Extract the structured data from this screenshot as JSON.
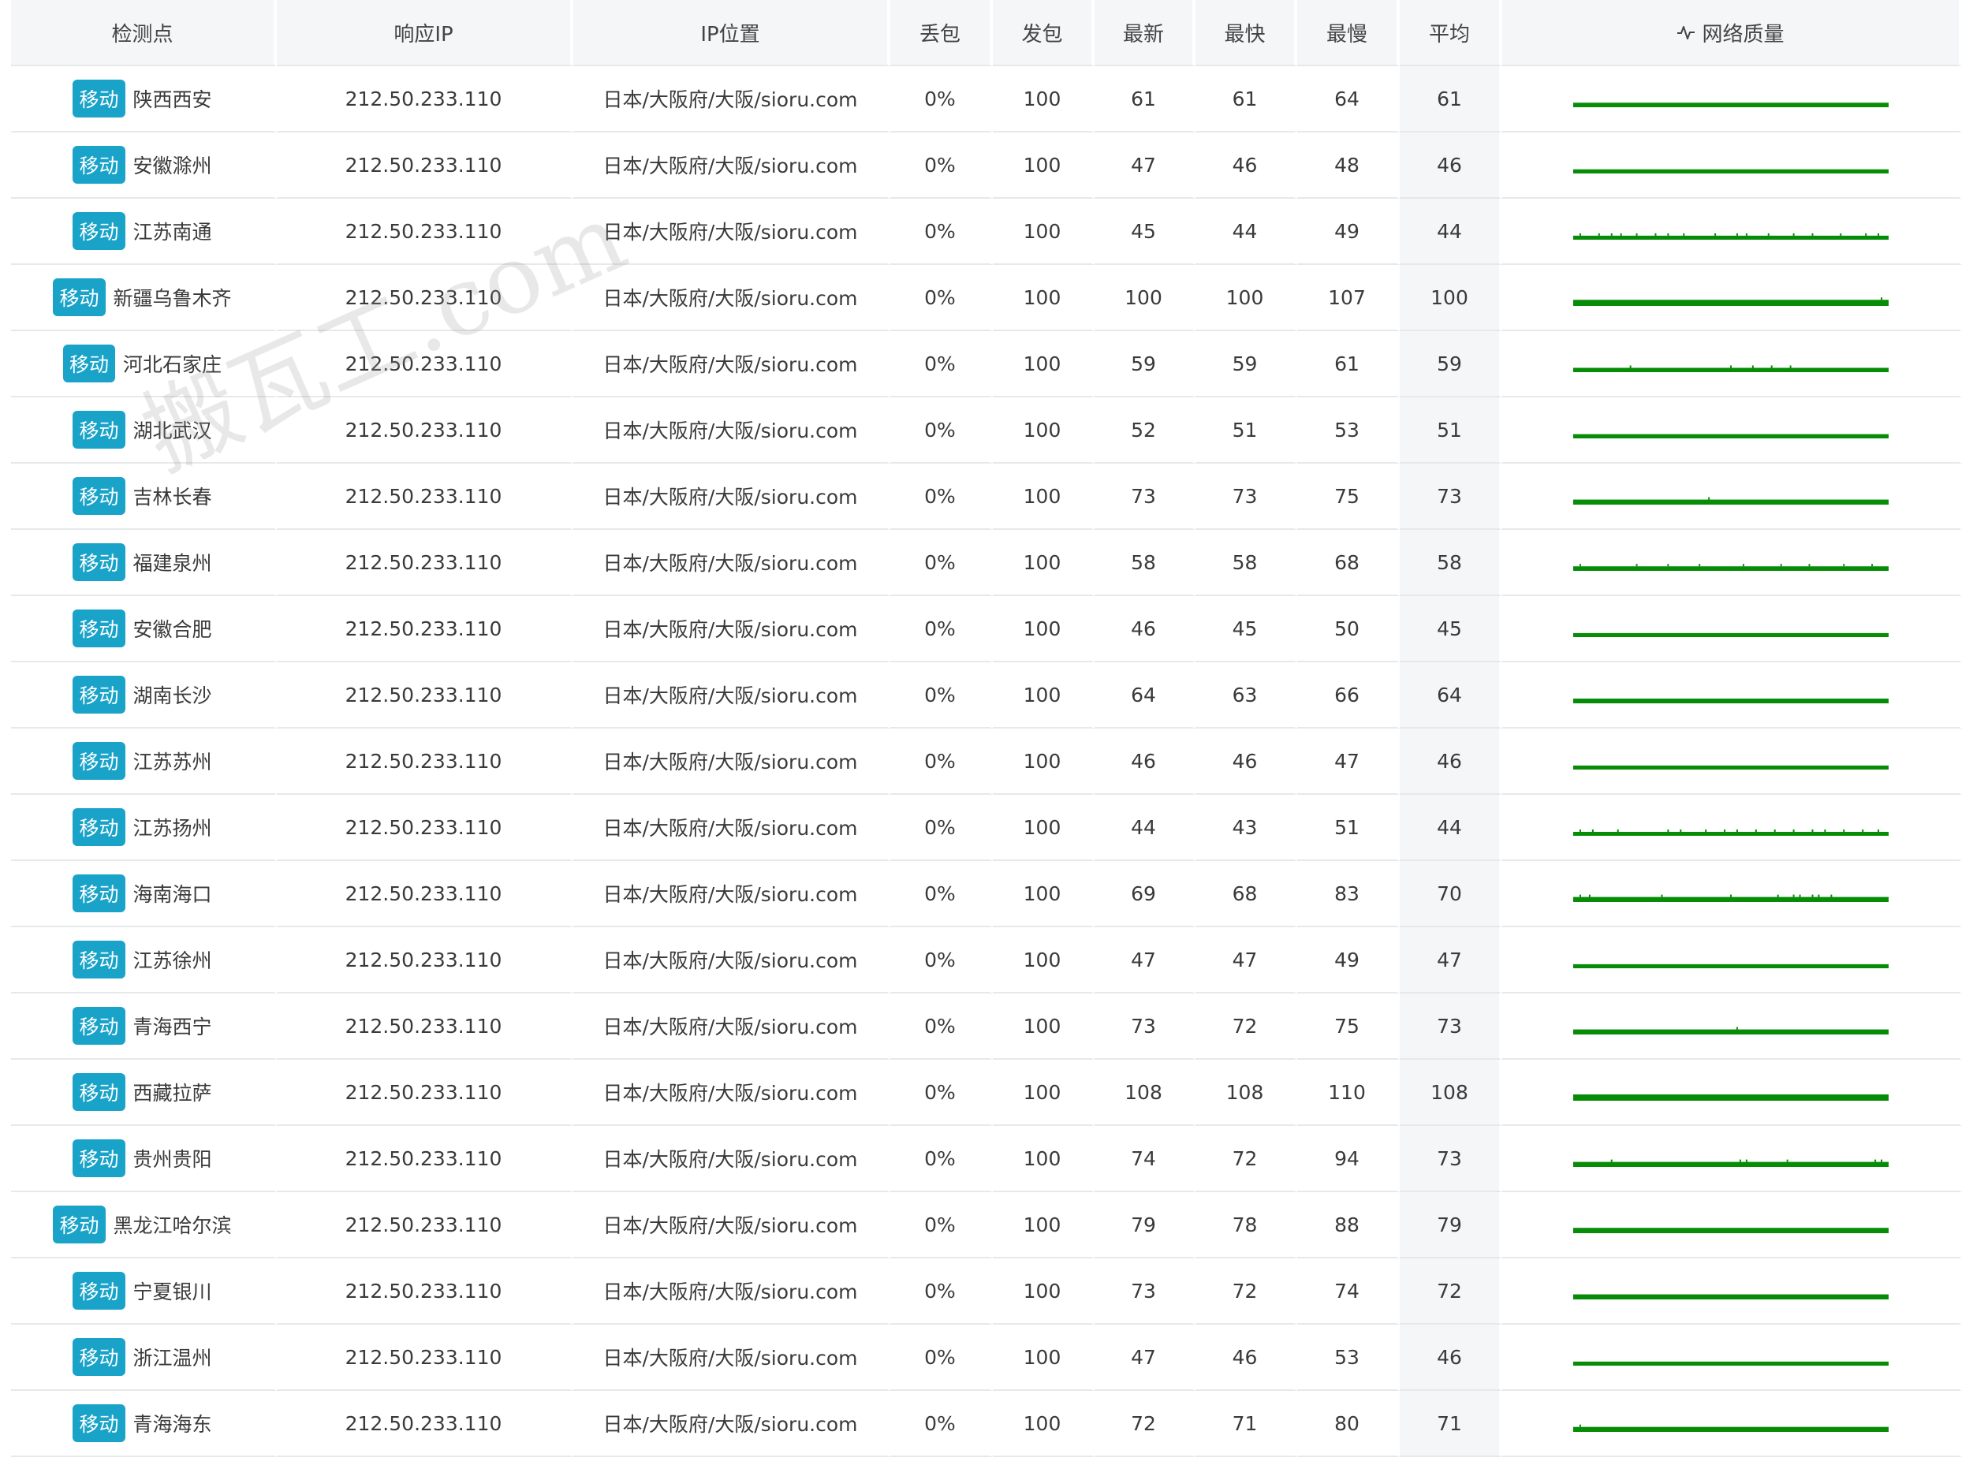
{
  "columns": [
    "检测点",
    "响应IP",
    "IP位置",
    "丢包",
    "发包",
    "最新",
    "最快",
    "最慢",
    "平均",
    "网络质量"
  ],
  "quality_color": "#078c07",
  "badge_color": "#1aa3c9",
  "watermark": "搬瓦工.com",
  "rows": [
    {
      "isp": "移动",
      "node": "陕西西安",
      "ip": "212.50.233.110",
      "location": "日本/大阪府/大阪/sioru.com",
      "loss": "0%",
      "sent": "100",
      "latest": "61",
      "fastest": "61",
      "slowest": "64",
      "avg": "61",
      "quality_level": 0.55,
      "spikes": []
    },
    {
      "isp": "移动",
      "node": "安徽滁州",
      "ip": "212.50.233.110",
      "location": "日本/大阪府/大阪/sioru.com",
      "loss": "0%",
      "sent": "100",
      "latest": "47",
      "fastest": "46",
      "slowest": "48",
      "avg": "46",
      "quality_level": 0.45,
      "spikes": []
    },
    {
      "isp": "移动",
      "node": "江苏南通",
      "ip": "212.50.233.110",
      "location": "日本/大阪府/大阪/sioru.com",
      "loss": "0%",
      "sent": "100",
      "latest": "45",
      "fastest": "44",
      "slowest": "49",
      "avg": "44",
      "quality_level": 0.42,
      "spikes": [
        0.02,
        0.08,
        0.12,
        0.15,
        0.2,
        0.26,
        0.3,
        0.35,
        0.45,
        0.52,
        0.55,
        0.62,
        0.7,
        0.76,
        0.85,
        0.93,
        0.97
      ]
    },
    {
      "isp": "移动",
      "node": "新疆乌鲁木齐",
      "ip": "212.50.233.110",
      "location": "日本/大阪府/大阪/sioru.com",
      "loss": "0%",
      "sent": "100",
      "latest": "100",
      "fastest": "100",
      "slowest": "107",
      "avg": "100",
      "quality_level": 0.95,
      "spikes": [
        0.98
      ]
    },
    {
      "isp": "移动",
      "node": "河北石家庄",
      "ip": "212.50.233.110",
      "location": "日本/大阪府/大阪/sioru.com",
      "loss": "0%",
      "sent": "100",
      "latest": "59",
      "fastest": "59",
      "slowest": "61",
      "avg": "59",
      "quality_level": 0.5,
      "spikes": [
        0.18,
        0.5,
        0.57,
        0.63,
        0.69
      ]
    },
    {
      "isp": "移动",
      "node": "湖北武汉",
      "ip": "212.50.233.110",
      "location": "日本/大阪府/大阪/sioru.com",
      "loss": "0%",
      "sent": "100",
      "latest": "52",
      "fastest": "51",
      "slowest": "53",
      "avg": "51",
      "quality_level": 0.48,
      "spikes": []
    },
    {
      "isp": "移动",
      "node": "吉林长春",
      "ip": "212.50.233.110",
      "location": "日本/大阪府/大阪/sioru.com",
      "loss": "0%",
      "sent": "100",
      "latest": "73",
      "fastest": "73",
      "slowest": "75",
      "avg": "73",
      "quality_level": 0.68,
      "spikes": [
        0.43
      ]
    },
    {
      "isp": "移动",
      "node": "福建泉州",
      "ip": "212.50.233.110",
      "location": "日本/大阪府/大阪/sioru.com",
      "loss": "0%",
      "sent": "100",
      "latest": "58",
      "fastest": "58",
      "slowest": "68",
      "avg": "58",
      "quality_level": 0.55,
      "spikes": [
        0.02,
        0.2,
        0.3,
        0.4,
        0.54,
        0.66,
        0.75,
        0.86,
        0.95
      ]
    },
    {
      "isp": "移动",
      "node": "安徽合肥",
      "ip": "212.50.233.110",
      "location": "日本/大阪府/大阪/sioru.com",
      "loss": "0%",
      "sent": "100",
      "latest": "46",
      "fastest": "45",
      "slowest": "50",
      "avg": "45",
      "quality_level": 0.42,
      "spikes": []
    },
    {
      "isp": "移动",
      "node": "湖南长沙",
      "ip": "212.50.233.110",
      "location": "日本/大阪府/大阪/sioru.com",
      "loss": "0%",
      "sent": "100",
      "latest": "64",
      "fastest": "63",
      "slowest": "66",
      "avg": "64",
      "quality_level": 0.6,
      "spikes": []
    },
    {
      "isp": "移动",
      "node": "江苏苏州",
      "ip": "212.50.233.110",
      "location": "日本/大阪府/大阪/sioru.com",
      "loss": "0%",
      "sent": "100",
      "latest": "46",
      "fastest": "46",
      "slowest": "47",
      "avg": "46",
      "quality_level": 0.42,
      "spikes": []
    },
    {
      "isp": "移动",
      "node": "江苏扬州",
      "ip": "212.50.233.110",
      "location": "日本/大阪府/大阪/sioru.com",
      "loss": "0%",
      "sent": "100",
      "latest": "44",
      "fastest": "43",
      "slowest": "51",
      "avg": "44",
      "quality_level": 0.4,
      "spikes": [
        0.02,
        0.06,
        0.14,
        0.3,
        0.34,
        0.42,
        0.48,
        0.52,
        0.58,
        0.64,
        0.7,
        0.76,
        0.8,
        0.86,
        0.92,
        0.97
      ]
    },
    {
      "isp": "移动",
      "node": "海南海口",
      "ip": "212.50.233.110",
      "location": "日本/大阪府/大阪/sioru.com",
      "loss": "0%",
      "sent": "100",
      "latest": "69",
      "fastest": "68",
      "slowest": "83",
      "avg": "70",
      "quality_level": 0.68,
      "spikes": [
        0.02,
        0.05,
        0.28,
        0.5,
        0.65,
        0.7,
        0.72,
        0.76,
        0.78,
        0.82
      ]
    },
    {
      "isp": "移动",
      "node": "江苏徐州",
      "ip": "212.50.233.110",
      "location": "日本/大阪府/大阪/sioru.com",
      "loss": "0%",
      "sent": "100",
      "latest": "47",
      "fastest": "47",
      "slowest": "49",
      "avg": "47",
      "quality_level": 0.43,
      "spikes": []
    },
    {
      "isp": "移动",
      "node": "青海西宁",
      "ip": "212.50.233.110",
      "location": "日本/大阪府/大阪/sioru.com",
      "loss": "0%",
      "sent": "100",
      "latest": "73",
      "fastest": "72",
      "slowest": "75",
      "avg": "73",
      "quality_level": 0.68,
      "spikes": [
        0.52
      ]
    },
    {
      "isp": "移动",
      "node": "西藏拉萨",
      "ip": "212.50.233.110",
      "location": "日本/大阪府/大阪/sioru.com",
      "loss": "0%",
      "sent": "100",
      "latest": "108",
      "fastest": "108",
      "slowest": "110",
      "avg": "108",
      "quality_level": 1.0,
      "spikes": []
    },
    {
      "isp": "移动",
      "node": "贵州贵阳",
      "ip": "212.50.233.110",
      "location": "日本/大阪府/大阪/sioru.com",
      "loss": "0%",
      "sent": "100",
      "latest": "74",
      "fastest": "72",
      "slowest": "94",
      "avg": "73",
      "quality_level": 0.68,
      "spikes": [
        0.12,
        0.53,
        0.55,
        0.68,
        0.96,
        0.98
      ]
    },
    {
      "isp": "移动",
      "node": "黑龙江哈尔滨",
      "ip": "212.50.233.110",
      "location": "日本/大阪府/大阪/sioru.com",
      "loss": "0%",
      "sent": "100",
      "latest": "79",
      "fastest": "78",
      "slowest": "88",
      "avg": "79",
      "quality_level": 0.75,
      "spikes": []
    },
    {
      "isp": "移动",
      "node": "宁夏银川",
      "ip": "212.50.233.110",
      "location": "日本/大阪府/大阪/sioru.com",
      "loss": "0%",
      "sent": "100",
      "latest": "73",
      "fastest": "72",
      "slowest": "74",
      "avg": "72",
      "quality_level": 0.68,
      "spikes": []
    },
    {
      "isp": "移动",
      "node": "浙江温州",
      "ip": "212.50.233.110",
      "location": "日本/大阪府/大阪/sioru.com",
      "loss": "0%",
      "sent": "100",
      "latest": "47",
      "fastest": "46",
      "slowest": "53",
      "avg": "46",
      "quality_level": 0.43,
      "spikes": []
    },
    {
      "isp": "移动",
      "node": "青海海东",
      "ip": "212.50.233.110",
      "location": "日本/大阪府/大阪/sioru.com",
      "loss": "0%",
      "sent": "100",
      "latest": "72",
      "fastest": "71",
      "slowest": "80",
      "avg": "71",
      "quality_level": 0.66,
      "spikes": [
        0.02
      ]
    }
  ]
}
